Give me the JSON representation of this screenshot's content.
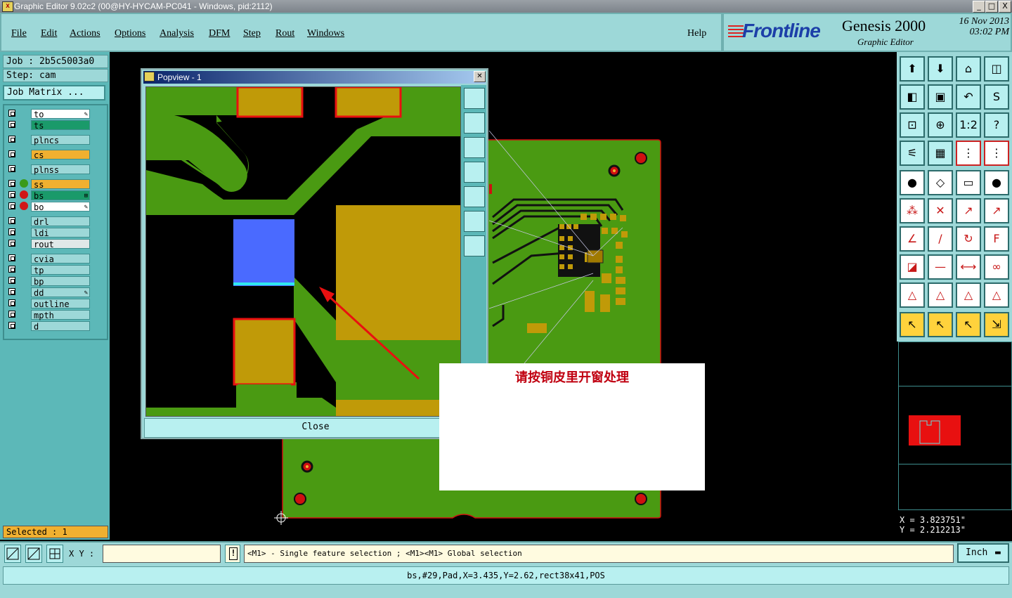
{
  "window": {
    "title": "Graphic Editor 9.02c2 (00@HY-HYCAM-PC041 - Windows, pid:2112)",
    "buttons": {
      "minimize": "_",
      "maximize": "□",
      "close": "X"
    }
  },
  "menu": [
    "File",
    "Edit",
    "Actions",
    "Options",
    "Analysis",
    "DFM",
    "Step",
    "Rout",
    "Windows"
  ],
  "help": "Help",
  "branding": {
    "company": "Frontline",
    "product": "Genesis 2000",
    "subtitle": "Graphic Editor",
    "date": "16 Nov 2013",
    "time": "03:02 PM"
  },
  "job": {
    "job_label": "Job : 2b5c5003a0",
    "step_label": "Step: cam",
    "matrix_button": "Job Matrix ..."
  },
  "layers": [
    {
      "name": "to",
      "color": "#ffffff",
      "mark": "✎"
    },
    {
      "name": "ts",
      "color": "#1a9a6a"
    },
    {
      "name": "plncs",
      "color": "#9dd8d8"
    },
    {
      "name": "cs",
      "color": "#f0b030"
    },
    {
      "name": "plnss",
      "color": "#9dd8d8"
    },
    {
      "name": "ss",
      "color": "#f0b030"
    },
    {
      "name": "bs",
      "color": "#1a9a6a",
      "mark": "⊞"
    },
    {
      "name": "bo",
      "color": "#ffffff",
      "mark": "✎"
    },
    {
      "name": "drl",
      "color": "#9dd8d8"
    },
    {
      "name": "ldi",
      "color": "#9dd8d8"
    },
    {
      "name": "rout",
      "color": "#e0e8e8"
    },
    {
      "name": "cvia",
      "color": "#9dd8d8"
    },
    {
      "name": "tp",
      "color": "#9dd8d8"
    },
    {
      "name": "bp",
      "color": "#9dd8d8"
    },
    {
      "name": "dd",
      "color": "#9dd8d8",
      "mark": "✎"
    },
    {
      "name": "outline",
      "color": "#9dd8d8"
    },
    {
      "name": "mpth",
      "color": "#9dd8d8"
    },
    {
      "name": "d",
      "color": "#9dd8d8"
    }
  ],
  "selected": "Selected : 1",
  "popview": {
    "title": "Popview - 1",
    "close_label": "Close"
  },
  "note": {
    "text": "请按铜皮里开窗处理"
  },
  "coords": {
    "x": "X = 3.823751\"",
    "y": "Y = 2.212213\""
  },
  "command": {
    "xy_label": "X Y :",
    "xy_value": "",
    "hint": "<M1> - Single feature selection ; <M1><M1> Global selection",
    "units": "Inch"
  },
  "status_line": "bs,#29,Pad,X=3.435,Y=2.62,rect38x41,POS",
  "colors": {
    "panel": "#9dd8d8",
    "copper": "#4a9a12",
    "pad": "#c09a08",
    "highlight": "#4a6aff",
    "note_text": "#c00010"
  }
}
